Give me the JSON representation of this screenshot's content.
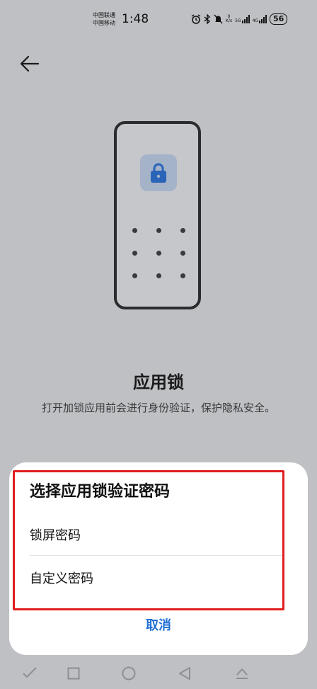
{
  "status_bar": {
    "carrier_1": "中国联通",
    "carrier_2": "中国移动",
    "time": "1:48",
    "net_speed_value": "0",
    "net_speed_unit": "K/s",
    "signal_1_type": "5G",
    "signal_2_type": "4G",
    "battery": "56",
    "icons": [
      "alarm-icon",
      "bluetooth-icon",
      "mute-icon",
      "signal-icon",
      "battery-icon"
    ]
  },
  "header": {
    "back_icon": "back-arrow-icon"
  },
  "illustration": {
    "lock_icon": "lock-icon",
    "pattern_dots": 9,
    "lock_tile_color": "#a4b3c8",
    "lock_color": "#2a64b8"
  },
  "main": {
    "title": "应用锁",
    "description": "打开加锁应用前会进行身份验证，保护隐私安全。"
  },
  "dialog": {
    "title": "选择应用锁验证密码",
    "options": [
      {
        "label": "锁屏密码"
      },
      {
        "label": "自定义密码"
      }
    ],
    "cancel_label": "取消",
    "accent_color": "#1f6fd6",
    "highlight_color": "#e11d1d"
  },
  "nav_bar": {
    "icons": [
      "back-nav-icon",
      "recents-nav-icon",
      "home-nav-icon",
      "triangle-nav-icon",
      "keyboard-hide-icon"
    ]
  }
}
